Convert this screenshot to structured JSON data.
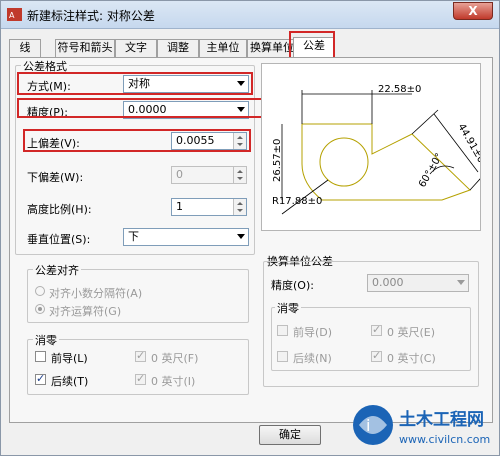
{
  "window": {
    "title": "新建标注样式: 对称公差",
    "close_label": "X",
    "app_icon": "autocad-app-icon"
  },
  "tabs": [
    {
      "label": "线"
    },
    {
      "label": "符号和箭头"
    },
    {
      "label": "文字"
    },
    {
      "label": "调整"
    },
    {
      "label": "主单位"
    },
    {
      "label": "换算单位"
    },
    {
      "label": "公差",
      "active": true
    }
  ],
  "tolerance_format": {
    "group_title": "公差格式",
    "method_label": "方式(M):",
    "method_value": "对称",
    "precision_label": "精度(P):",
    "precision_value": "0.0000",
    "upper_label": "上偏差(V):",
    "upper_value": "0.0055",
    "lower_label": "下偏差(W):",
    "lower_value": "0",
    "scale_label": "高度比例(H):",
    "scale_value": "1",
    "vpos_label": "垂直位置(S):",
    "vpos_value": "下"
  },
  "tolerance_alignment": {
    "group_title": "公差对齐",
    "option1": "对齐小数分隔符(A)",
    "option2": "对齐运算符(G)"
  },
  "zero_suppression": {
    "group_title": "消零",
    "leading": "前导(L)",
    "trailing": "后续(T)",
    "feet": "0 英尺(F)",
    "inches": "0 英寸(I)"
  },
  "preview": {
    "dim_top": "22.58±0",
    "dim_left": "26.57±0",
    "dim_right": "44.91±0",
    "dim_angle": "60°±0°",
    "dim_radius": "R17.88±0"
  },
  "alt_units": {
    "group_title": "换算单位公差",
    "precision_label": "精度(O):",
    "precision_value": "0.000",
    "zero_title": "消零",
    "leading": "前导(D)",
    "trailing": "后续(N)",
    "feet": "0 英尺(E)",
    "inches": "0 英寸(C)"
  },
  "buttons": {
    "ok": "确定"
  },
  "watermark": {
    "name": "土木工程网",
    "url": "www.civilcn.com"
  },
  "colors": {
    "highlight": "#d22727",
    "accent_yellow": "#b5a100",
    "brand_blue": "#1b64b6"
  }
}
